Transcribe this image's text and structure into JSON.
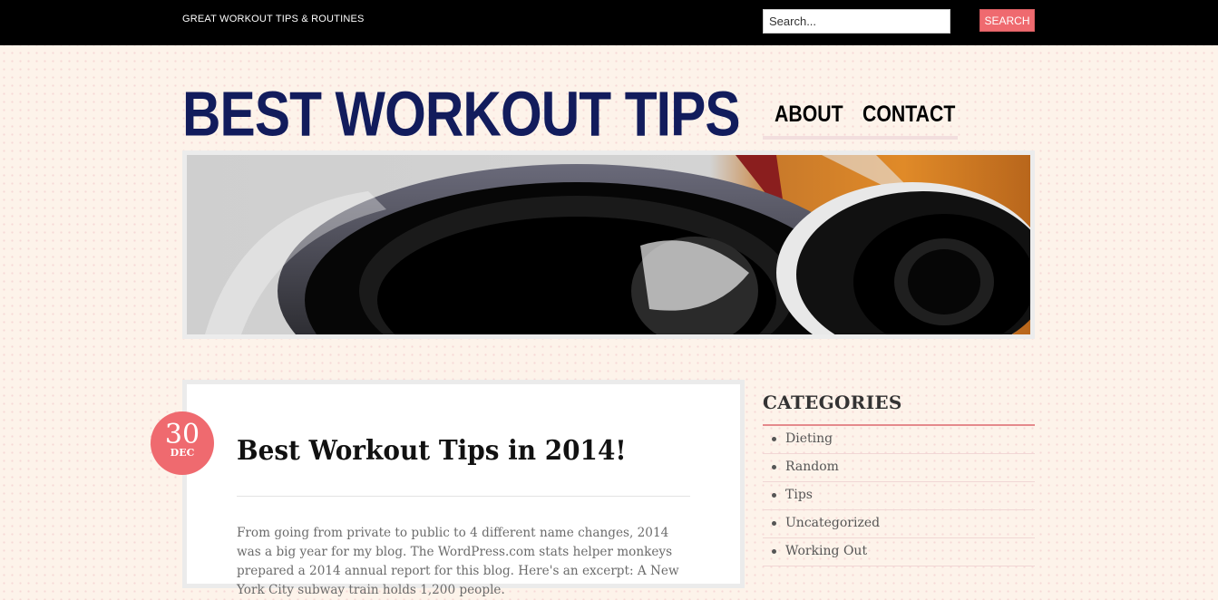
{
  "topbar": {
    "tagline": "GREAT WORKOUT TIPS & ROUTINES",
    "search_placeholder": "Search...",
    "search_button": "Search"
  },
  "header": {
    "site_title": "BEST WORKOUT TIPS",
    "nav": [
      "ABOUT",
      "CONTACT"
    ]
  },
  "post": {
    "date_day": "30",
    "date_month": "DEC",
    "title": "Best Workout Tips in 2014!",
    "excerpt": "From going from private to public to 4 different name changes, 2014 was a big year for my blog. The WordPress.com stats helper monkeys prepared a 2014 annual report for this blog. Here's an excerpt: A New York City subway train holds 1,200 people."
  },
  "sidebar": {
    "widget_title": "CATEGORIES",
    "categories": [
      "Dieting",
      "Random",
      "Tips",
      "Uncategorized",
      "Working Out"
    ]
  },
  "colors": {
    "topbar": "#000000",
    "title_navy": "#121c5c",
    "accent": "#ef6a6f",
    "page_bg": "#fdf3ea"
  }
}
